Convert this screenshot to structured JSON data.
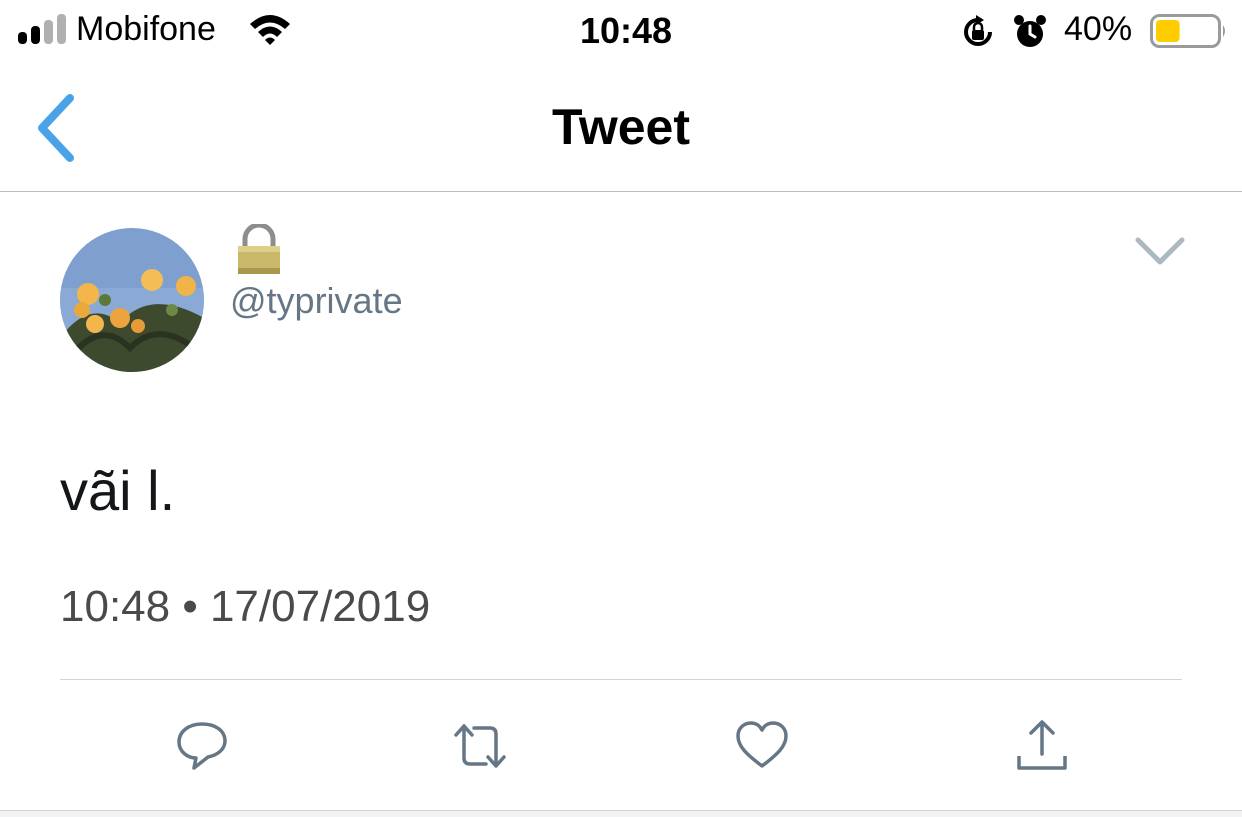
{
  "status_bar": {
    "carrier": "Mobifone",
    "time": "10:48",
    "battery_percent": "40%",
    "battery_level": 0.4,
    "battery_color": "#ffcc00",
    "signal_bars_filled": 2,
    "signal_bars_total": 4
  },
  "nav": {
    "title": "Tweet",
    "accent_color": "#4aa3e8"
  },
  "tweet": {
    "locked_icon": "padlock-icon",
    "handle": "@typrivate",
    "text": "vãi l.",
    "timestamp": "10:48 • 17/07/2019"
  },
  "actions": [
    {
      "name": "reply",
      "icon": "reply-icon"
    },
    {
      "name": "retweet",
      "icon": "retweet-icon"
    },
    {
      "name": "like",
      "icon": "heart-icon"
    },
    {
      "name": "share",
      "icon": "share-icon"
    }
  ]
}
